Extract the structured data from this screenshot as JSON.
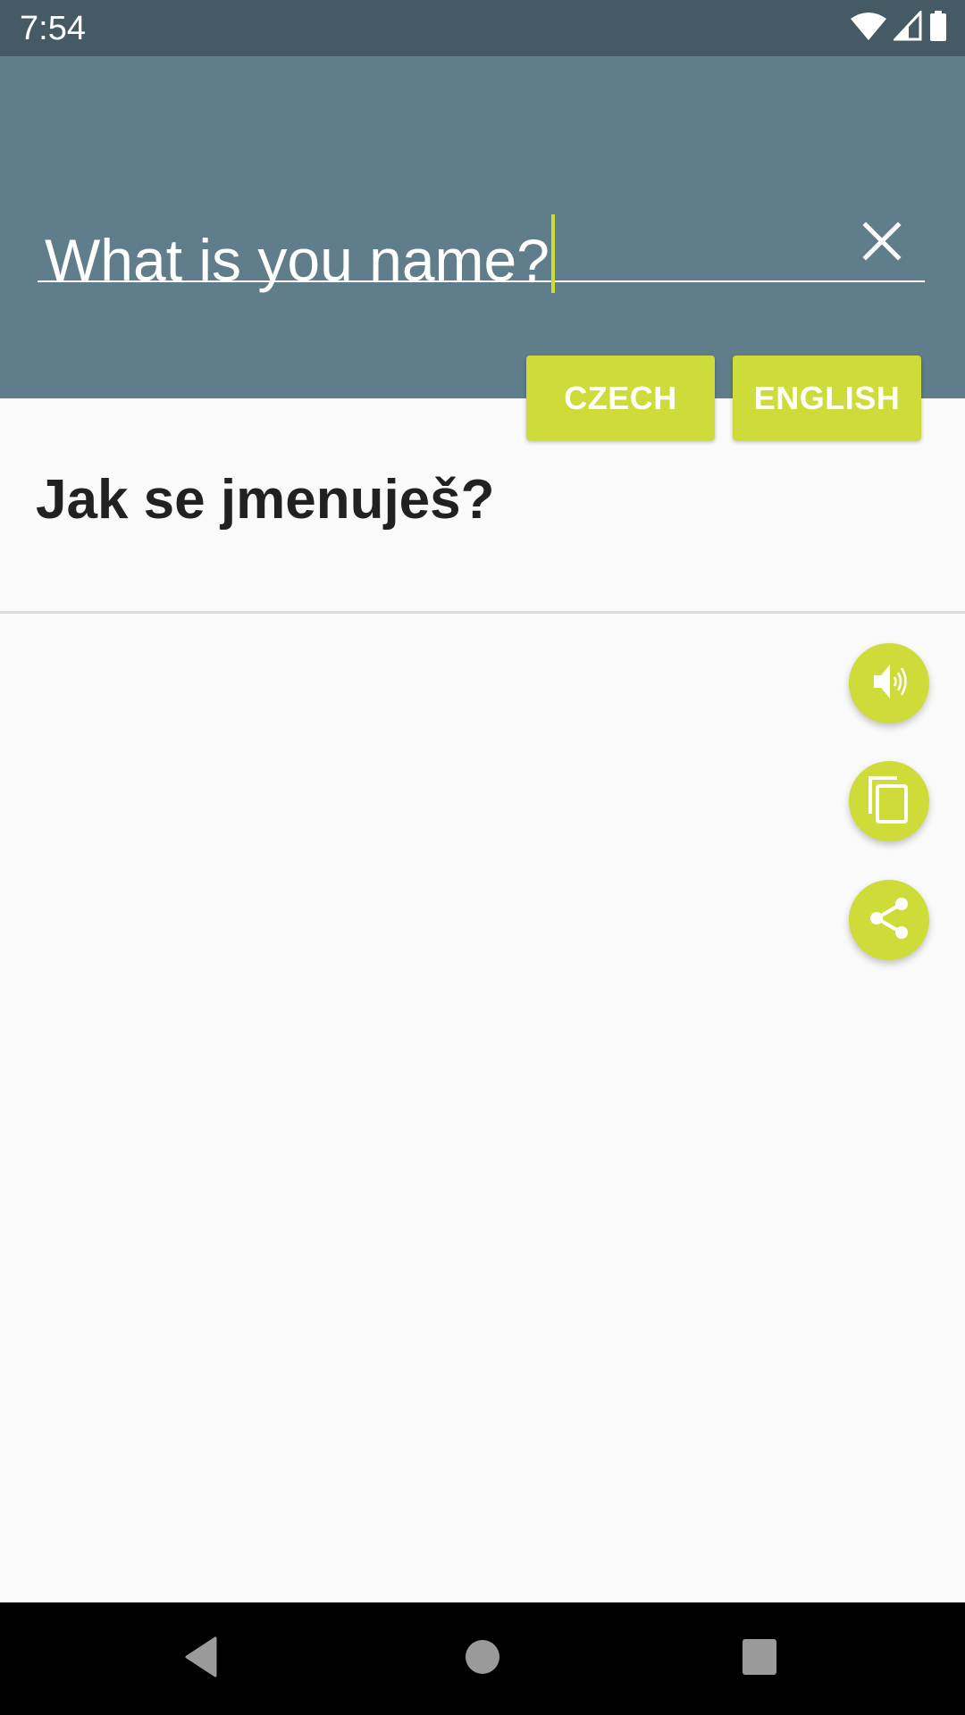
{
  "status_bar": {
    "time": "7:54",
    "icons": [
      "wifi-icon",
      "cellular-signal-icon",
      "battery-icon"
    ]
  },
  "search": {
    "value": "What is you name?",
    "clear_icon": "close-icon"
  },
  "language_buttons": {
    "source_label": "CZECH",
    "target_label": "ENGLISH"
  },
  "translation": {
    "text": "Jak se jmenuješ?"
  },
  "actions": [
    {
      "name": "speak",
      "icon": "volume-icon"
    },
    {
      "name": "copy",
      "icon": "copy-icon"
    },
    {
      "name": "share",
      "icon": "share-icon"
    }
  ],
  "navigation": {
    "buttons": [
      "back",
      "home",
      "recents"
    ]
  },
  "colors": {
    "status_bar": "#455a64",
    "header": "#607d8b",
    "accent": "#cddc39",
    "background": "#fafafa",
    "text": "#212121"
  }
}
